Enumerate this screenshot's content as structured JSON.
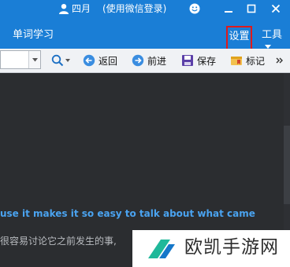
{
  "titlebar": {
    "user_name": "四月",
    "login_hint": "(使用微信登录)",
    "icons": [
      "user-icon",
      "smiley-icon",
      "minimize-icon",
      "maximize-icon",
      "close-icon"
    ]
  },
  "menubar": {
    "title": "单词学习",
    "settings_label": "设置",
    "tools_label": "工具",
    "highlight_color": "#e01a1a"
  },
  "toolbar": {
    "back_label": "返回",
    "forward_label": "前进",
    "save_label": "保存",
    "mark_label": "标记"
  },
  "content": {
    "english_text": "use it makes it so easy to talk about what came",
    "chinese_text": "很容易讨论它之前发生的事,"
  },
  "watermark": {
    "text": "欧凯手游网"
  },
  "colors": {
    "accent": "#1a7ed6",
    "link_text": "#4aa3f0",
    "background": "#2b2d30"
  }
}
